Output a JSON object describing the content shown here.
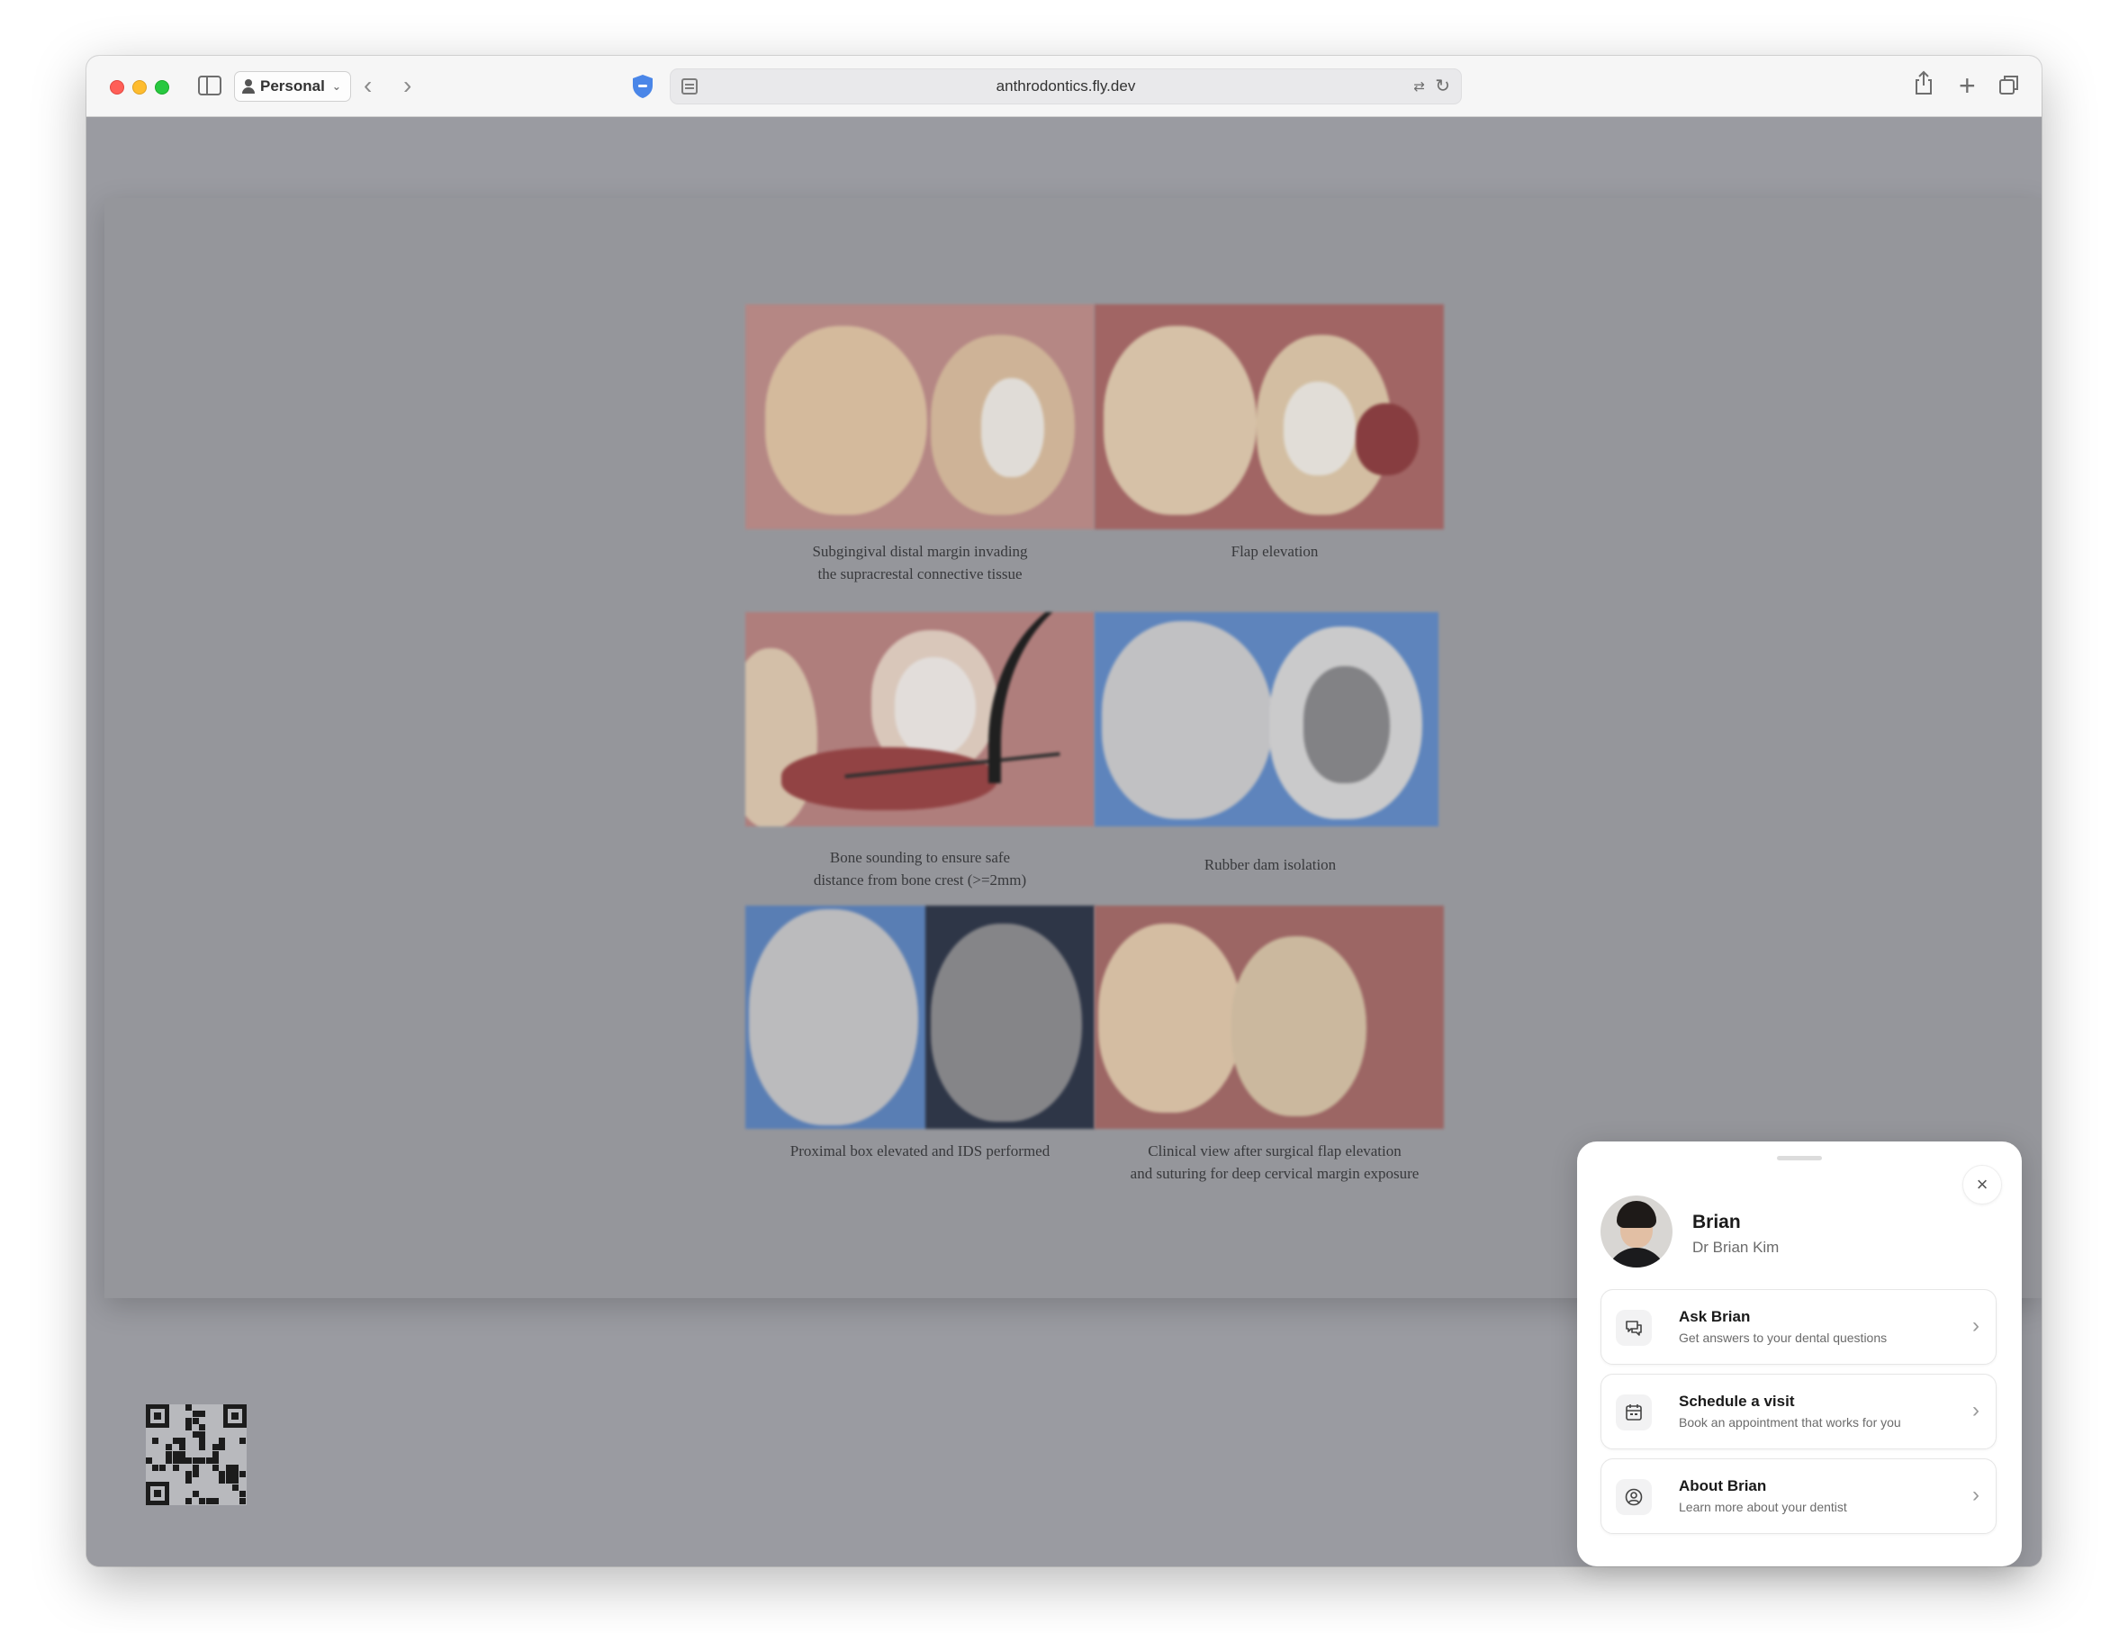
{
  "browser": {
    "profile_label": "Personal",
    "url": "anthrodontics.fly.dev"
  },
  "slide": {
    "captions": [
      "Subgingival distal margin invading\nthe supracrestal connective tissue",
      "Flap elevation",
      "Bone sounding to ensure safe\ndistance from bone crest (>=2mm)",
      "Rubber dam isolation",
      "Proximal box elevated and IDS performed",
      "Clinical view after surgical flap elevation\nand suturing for deep cervical margin exposure"
    ]
  },
  "widget": {
    "name": "Brian",
    "subtitle": "Dr Brian Kim",
    "close_icon": "x-icon",
    "actions": [
      {
        "title": "Ask Brian",
        "description": "Get answers to your dental questions",
        "icon": "chat-bubbles-icon"
      },
      {
        "title": "Schedule a visit",
        "description": "Book an appointment that works for you",
        "icon": "calendar-icon"
      },
      {
        "title": "About Brian",
        "description": "Learn more about your dentist",
        "icon": "user-circle-icon"
      }
    ]
  },
  "colors": {
    "accent_shield": "#4a86e8",
    "overlay": "#9a9ba1"
  }
}
